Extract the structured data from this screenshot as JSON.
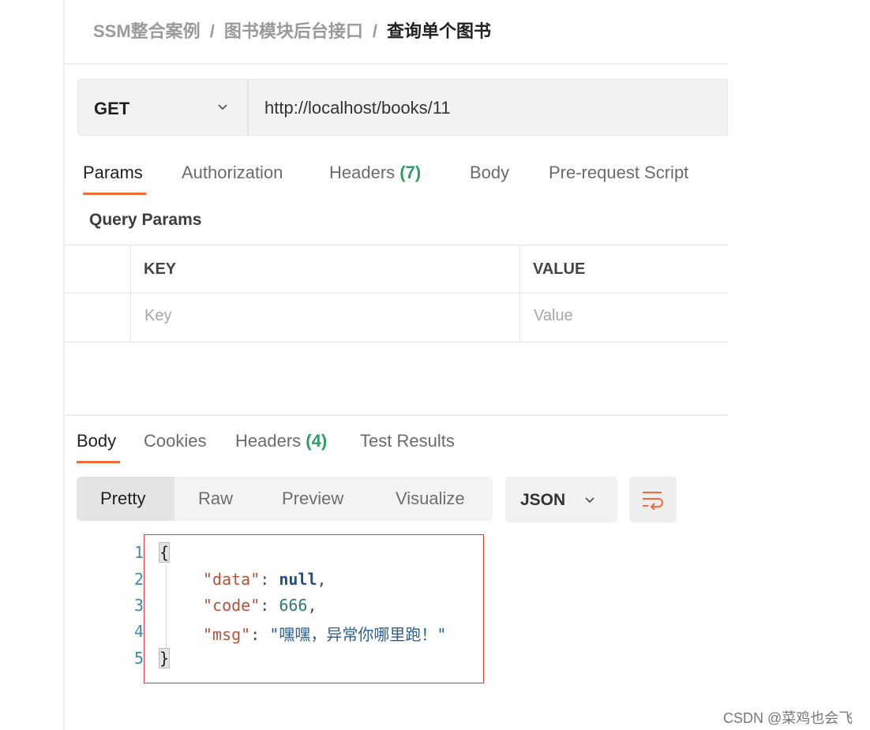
{
  "breadcrumb": {
    "items": [
      "SSM整合案例",
      "图书模块后台接口",
      "查询单个图书"
    ],
    "separator": "/"
  },
  "request": {
    "method": "GET",
    "url": "http://localhost/books/11"
  },
  "request_tabs": {
    "params": "Params",
    "authorization": "Authorization",
    "headers": "Headers",
    "headers_count": "(7)",
    "body": "Body",
    "pre_request": "Pre-request Script"
  },
  "query_params": {
    "title": "Query Params",
    "col_key": "KEY",
    "col_value": "VALUE",
    "key_placeholder": "Key",
    "value_placeholder": "Value"
  },
  "response_tabs": {
    "body": "Body",
    "cookies": "Cookies",
    "headers": "Headers",
    "headers_count": "(4)",
    "test_results": "Test Results"
  },
  "view_modes": {
    "pretty": "Pretty",
    "raw": "Raw",
    "preview": "Preview",
    "visualize": "Visualize",
    "format": "JSON"
  },
  "response": {
    "line_numbers": [
      "1",
      "2",
      "3",
      "4",
      "5"
    ],
    "open_brace": "{",
    "close_brace": "}",
    "fields": [
      {
        "key": "\"data\"",
        "value": "null"
      },
      {
        "key": "\"code\"",
        "value": "666"
      },
      {
        "key": "\"msg\"",
        "value": "\"嘿嘿，异常你哪里跑！\""
      }
    ]
  },
  "watermark": "CSDN @菜鸡也会飞",
  "colors": {
    "accent": "#f26b3a",
    "count_green": "#2e9d5f",
    "highlight_box": "#e23b3b"
  }
}
